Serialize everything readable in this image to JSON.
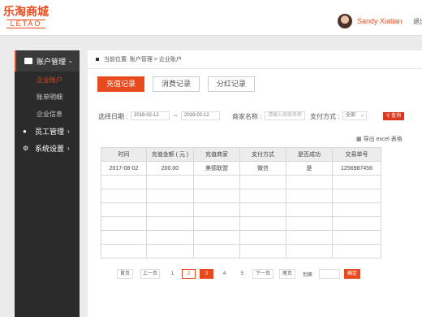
{
  "header": {
    "logo_cn": "乐淘商城",
    "logo_en": "LETAO",
    "username": "Sandy Xiatian",
    "logout": "退出"
  },
  "sidebar": {
    "account": "账户管理",
    "sub": [
      "企业账户",
      "账单明细",
      "企业信息"
    ],
    "employee": "员工管理",
    "settings": "系统设置"
  },
  "breadcrumb": "当前位置:  账户管理 > 企业账户",
  "tabs": [
    "充值记录",
    "消费记录",
    "分红记录"
  ],
  "filters": {
    "date_label": "选择日期 :",
    "date_from": "2018-02-12",
    "date_sep": "~",
    "date_to": "2018-02-12",
    "merchant_label": "商家名称 :",
    "merchant_placeholder": "请输入商家名称",
    "pay_label": "支付方式 :",
    "pay_value": "全部",
    "search": "查询"
  },
  "export_label": "导出 excel 表格",
  "table": {
    "headers": [
      "时间",
      "充值金额 ( 元 )",
      "充值商家",
      "支付方式",
      "是否成功",
      "交易单号"
    ],
    "rows": [
      [
        "2017-08-02",
        "200.00",
        "美德联盟",
        "微信",
        "是",
        "1256987456"
      ]
    ]
  },
  "pagination": {
    "first": "首页",
    "prev": "上一页",
    "pages": [
      "1",
      "2",
      "3",
      "4",
      "5"
    ],
    "next": "下一页",
    "last": "尾页",
    "goto": "到第",
    "confirm": "确定"
  },
  "colors": {
    "accent": "#e84a1d",
    "sidebar": "#2b2b2b"
  }
}
